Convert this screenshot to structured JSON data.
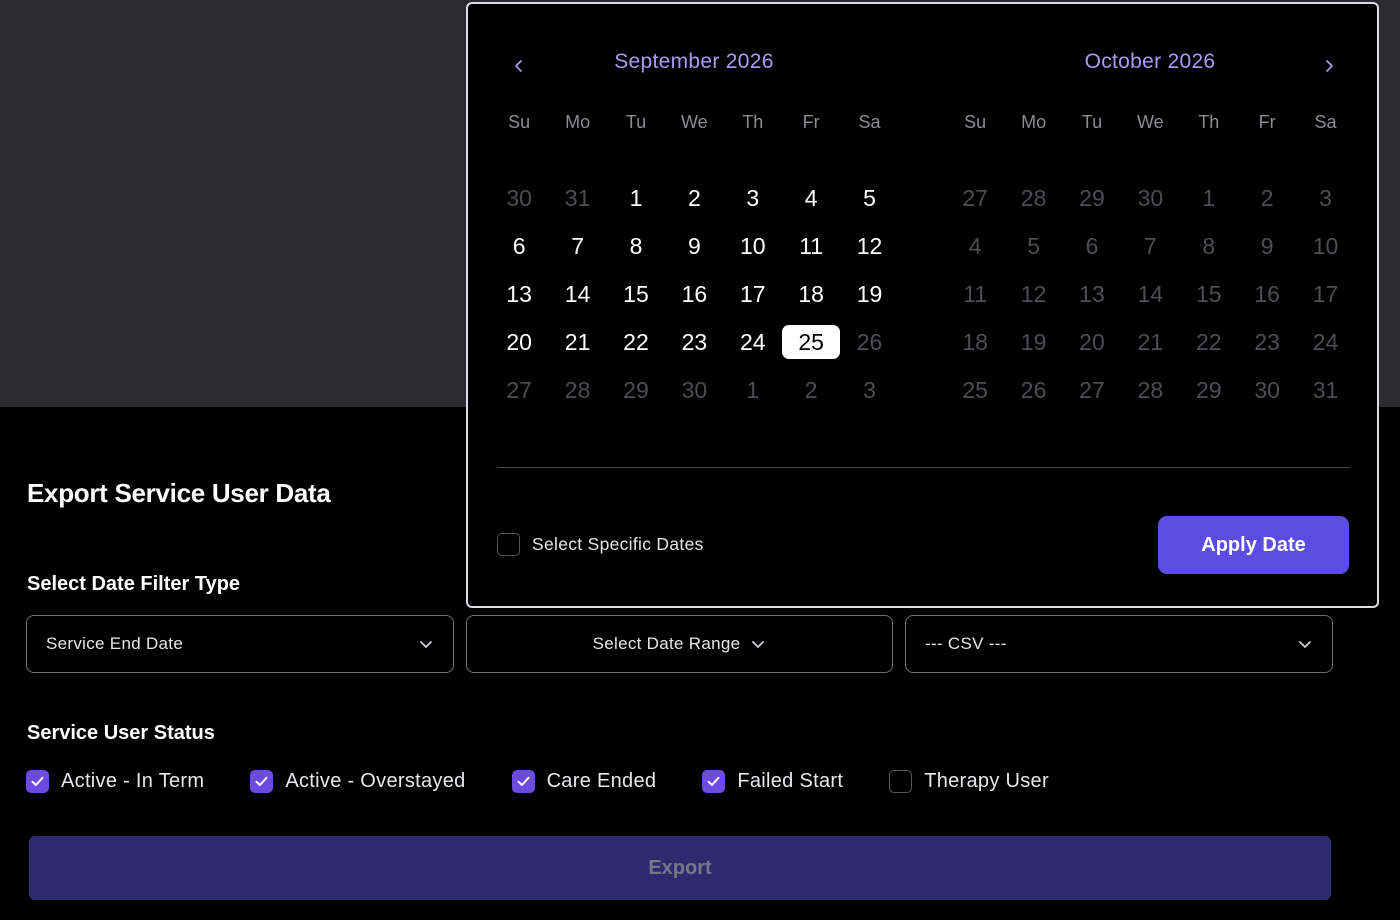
{
  "page": {
    "title": "Export Service User Data"
  },
  "filters": {
    "section_label": "Select Date Filter Type",
    "date_filter_type": "Service End Date",
    "date_range": "Select Date Range",
    "format": "--- CSV ---"
  },
  "status": {
    "section_label": "Service User Status",
    "options": [
      {
        "label": "Active - In Term",
        "checked": true
      },
      {
        "label": "Active - Overstayed",
        "checked": true
      },
      {
        "label": "Care Ended",
        "checked": true
      },
      {
        "label": "Failed Start",
        "checked": true
      },
      {
        "label": "Therapy User",
        "checked": false
      }
    ]
  },
  "export_label": "Export",
  "picker": {
    "weekdays": [
      "Su",
      "Mo",
      "Tu",
      "We",
      "Th",
      "Fr",
      "Sa"
    ],
    "months": [
      {
        "title": "September 2026",
        "days": [
          {
            "d": "30",
            "in": false
          },
          {
            "d": "31",
            "in": false
          },
          {
            "d": "1",
            "in": true
          },
          {
            "d": "2",
            "in": true
          },
          {
            "d": "3",
            "in": true
          },
          {
            "d": "4",
            "in": true
          },
          {
            "d": "5",
            "in": true
          },
          {
            "d": "6",
            "in": true
          },
          {
            "d": "7",
            "in": true
          },
          {
            "d": "8",
            "in": true
          },
          {
            "d": "9",
            "in": true
          },
          {
            "d": "10",
            "in": true
          },
          {
            "d": "11",
            "in": true
          },
          {
            "d": "12",
            "in": true
          },
          {
            "d": "13",
            "in": true
          },
          {
            "d": "14",
            "in": true
          },
          {
            "d": "15",
            "in": true
          },
          {
            "d": "16",
            "in": true
          },
          {
            "d": "17",
            "in": true
          },
          {
            "d": "18",
            "in": true
          },
          {
            "d": "19",
            "in": true
          },
          {
            "d": "20",
            "in": true
          },
          {
            "d": "21",
            "in": true
          },
          {
            "d": "22",
            "in": true
          },
          {
            "d": "23",
            "in": true
          },
          {
            "d": "24",
            "in": true
          },
          {
            "d": "25",
            "in": true,
            "selected": true
          },
          {
            "d": "26",
            "in": false
          },
          {
            "d": "27",
            "in": false
          },
          {
            "d": "28",
            "in": false
          },
          {
            "d": "29",
            "in": false
          },
          {
            "d": "30",
            "in": false
          },
          {
            "d": "1",
            "in": false
          },
          {
            "d": "2",
            "in": false
          },
          {
            "d": "3",
            "in": false
          }
        ]
      },
      {
        "title": "October 2026",
        "days": [
          {
            "d": "27",
            "in": false
          },
          {
            "d": "28",
            "in": false
          },
          {
            "d": "29",
            "in": false
          },
          {
            "d": "30",
            "in": false
          },
          {
            "d": "1",
            "in": false
          },
          {
            "d": "2",
            "in": false
          },
          {
            "d": "3",
            "in": false
          },
          {
            "d": "4",
            "in": false
          },
          {
            "d": "5",
            "in": false
          },
          {
            "d": "6",
            "in": false
          },
          {
            "d": "7",
            "in": false
          },
          {
            "d": "8",
            "in": false
          },
          {
            "d": "9",
            "in": false
          },
          {
            "d": "10",
            "in": false
          },
          {
            "d": "11",
            "in": false
          },
          {
            "d": "12",
            "in": false
          },
          {
            "d": "13",
            "in": false
          },
          {
            "d": "14",
            "in": false
          },
          {
            "d": "15",
            "in": false
          },
          {
            "d": "16",
            "in": false
          },
          {
            "d": "17",
            "in": false
          },
          {
            "d": "18",
            "in": false
          },
          {
            "d": "19",
            "in": false
          },
          {
            "d": "20",
            "in": false
          },
          {
            "d": "21",
            "in": false
          },
          {
            "d": "22",
            "in": false
          },
          {
            "d": "23",
            "in": false
          },
          {
            "d": "24",
            "in": false
          },
          {
            "d": "25",
            "in": false
          },
          {
            "d": "26",
            "in": false
          },
          {
            "d": "27",
            "in": false
          },
          {
            "d": "28",
            "in": false
          },
          {
            "d": "29",
            "in": false
          },
          {
            "d": "30",
            "in": false
          },
          {
            "d": "31",
            "in": false
          }
        ]
      }
    ],
    "specific_dates_label": "Select Specific Dates",
    "specific_dates_checked": false,
    "apply_label": "Apply Date",
    "icons": {
      "prev": "chevron-left-icon",
      "next": "chevron-right-icon"
    }
  },
  "colors": {
    "accent": "#5b4de2",
    "month_title": "#a99bf2",
    "checkbox_on": "#6c4ce0",
    "export_button": "#2e2a6e"
  }
}
